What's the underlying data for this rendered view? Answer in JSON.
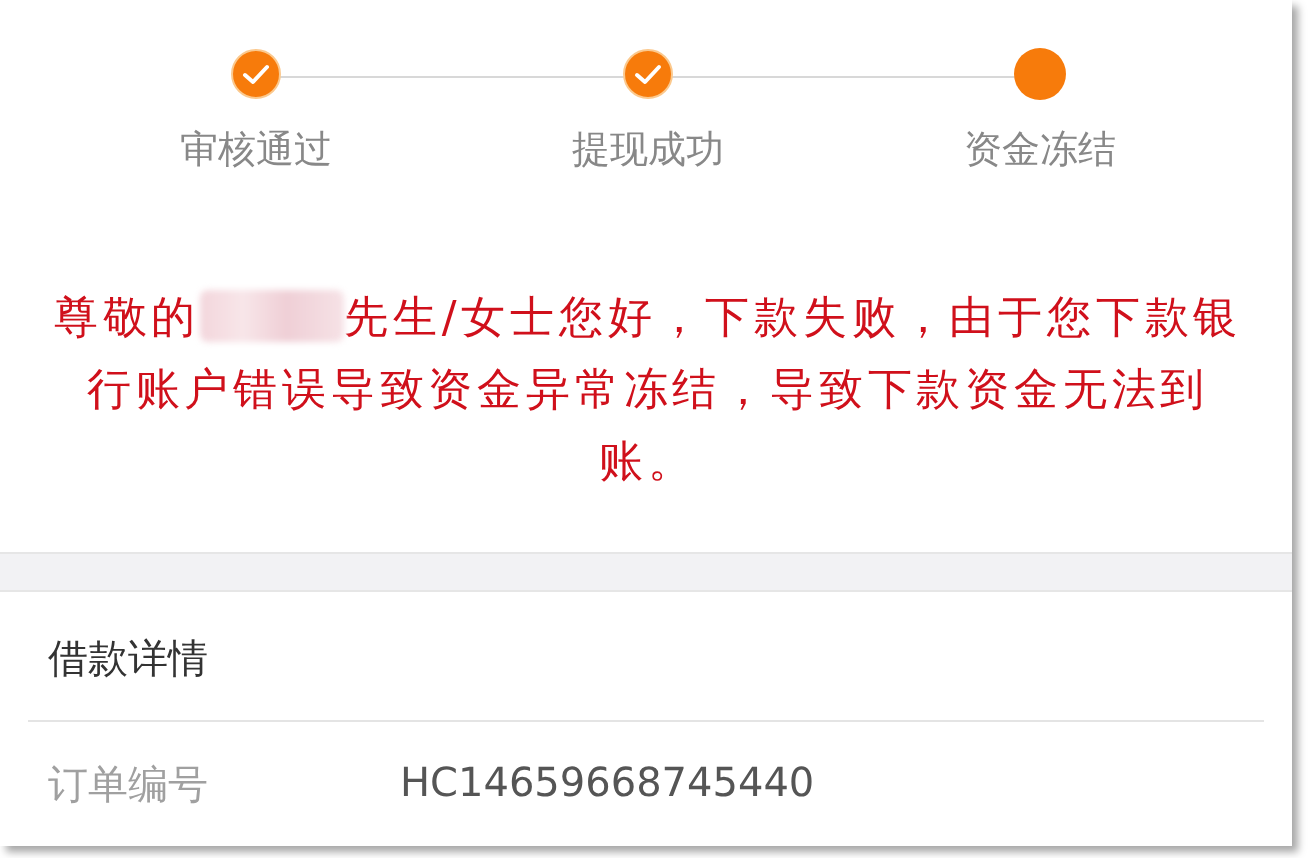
{
  "steps": [
    {
      "label": "审核通过",
      "kind": "done"
    },
    {
      "label": "提现成功",
      "kind": "done"
    },
    {
      "label": "资金冻结",
      "kind": "current"
    }
  ],
  "notice": {
    "before": "尊敬的",
    "redacted": true,
    "after": [
      "先生/女士您好，下款失败，由于您下款银",
      "行账户错误导致资金异常冻结，导致下款资金无法到",
      "账。"
    ]
  },
  "details": {
    "title": "借款详情",
    "rows": [
      {
        "label": "订单编号",
        "value": "HC14659668745440"
      }
    ]
  }
}
